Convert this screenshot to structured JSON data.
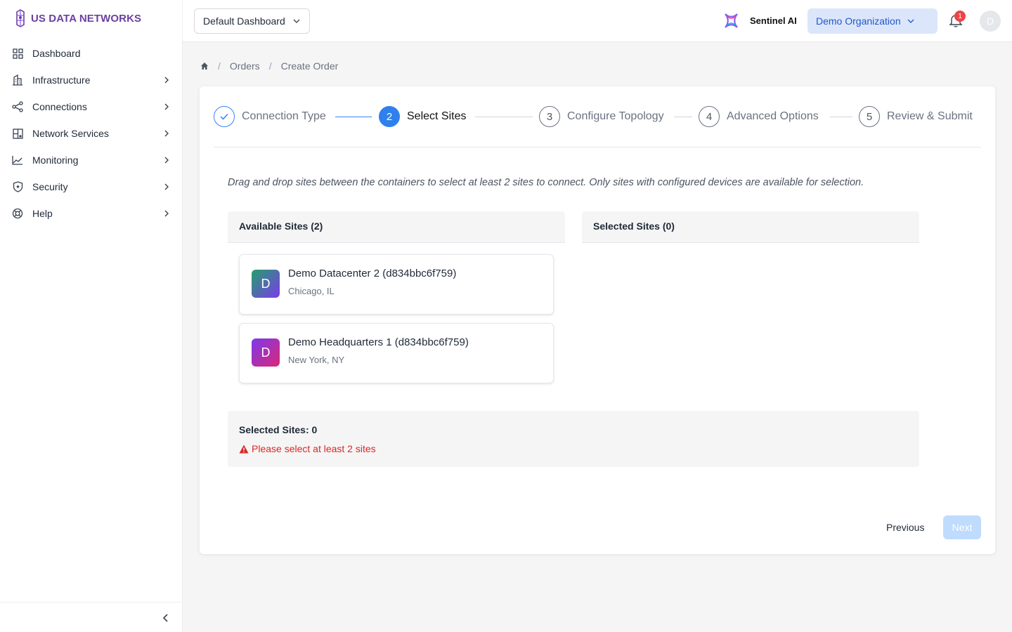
{
  "app": {
    "brand": "US DATA NETWORKS",
    "brand_color": "#6b3fa0"
  },
  "sidebar": {
    "items": [
      {
        "label": "Dashboard",
        "icon": "dashboard-grid-icon"
      },
      {
        "label": "Infrastructure",
        "icon": "building-icon"
      },
      {
        "label": "Connections",
        "icon": "share-nodes-icon"
      },
      {
        "label": "Network Services",
        "icon": "network-grid-icon"
      },
      {
        "label": "Monitoring",
        "icon": "line-chart-icon"
      },
      {
        "label": "Security",
        "icon": "shield-icon"
      },
      {
        "label": "Help",
        "icon": "lifebuoy-icon"
      }
    ]
  },
  "header": {
    "dashboard_select": "Default Dashboard",
    "sentinel_label": "Sentinel AI",
    "org_select": "Demo Organization",
    "notification_count": "1",
    "avatar_initial": "D"
  },
  "breadcrumb": {
    "items": [
      "Orders",
      "Create Order"
    ]
  },
  "steps": [
    {
      "number": "1",
      "label": "Connection Type",
      "status": "done"
    },
    {
      "number": "2",
      "label": "Select Sites",
      "status": "active"
    },
    {
      "number": "3",
      "label": "Configure Topology",
      "status": "pending"
    },
    {
      "number": "4",
      "label": "Advanced Options",
      "status": "pending"
    },
    {
      "number": "5",
      "label": "Review & Submit",
      "status": "pending"
    }
  ],
  "instructions": "Drag and drop sites between the containers to select at least 2 sites to connect. Only sites with configured devices are available for selection.",
  "available": {
    "title": "Available Sites (2)",
    "sites": [
      {
        "initial": "D",
        "name": "Demo Datacenter 2 (d834bbc6f759)",
        "location": "Chicago, IL"
      },
      {
        "initial": "D",
        "name": "Demo Headquarters 1 (d834bbc6f759)",
        "location": "New York, NY"
      }
    ]
  },
  "selected": {
    "title": "Selected Sites (0)"
  },
  "summary": {
    "title": "Selected Sites: 0",
    "error": "Please select at least 2 sites"
  },
  "actions": {
    "previous": "Previous",
    "next": "Next"
  },
  "colors": {
    "primary": "#2f80ed",
    "error": "#dc2626",
    "org_bg": "#dbe6fb"
  }
}
